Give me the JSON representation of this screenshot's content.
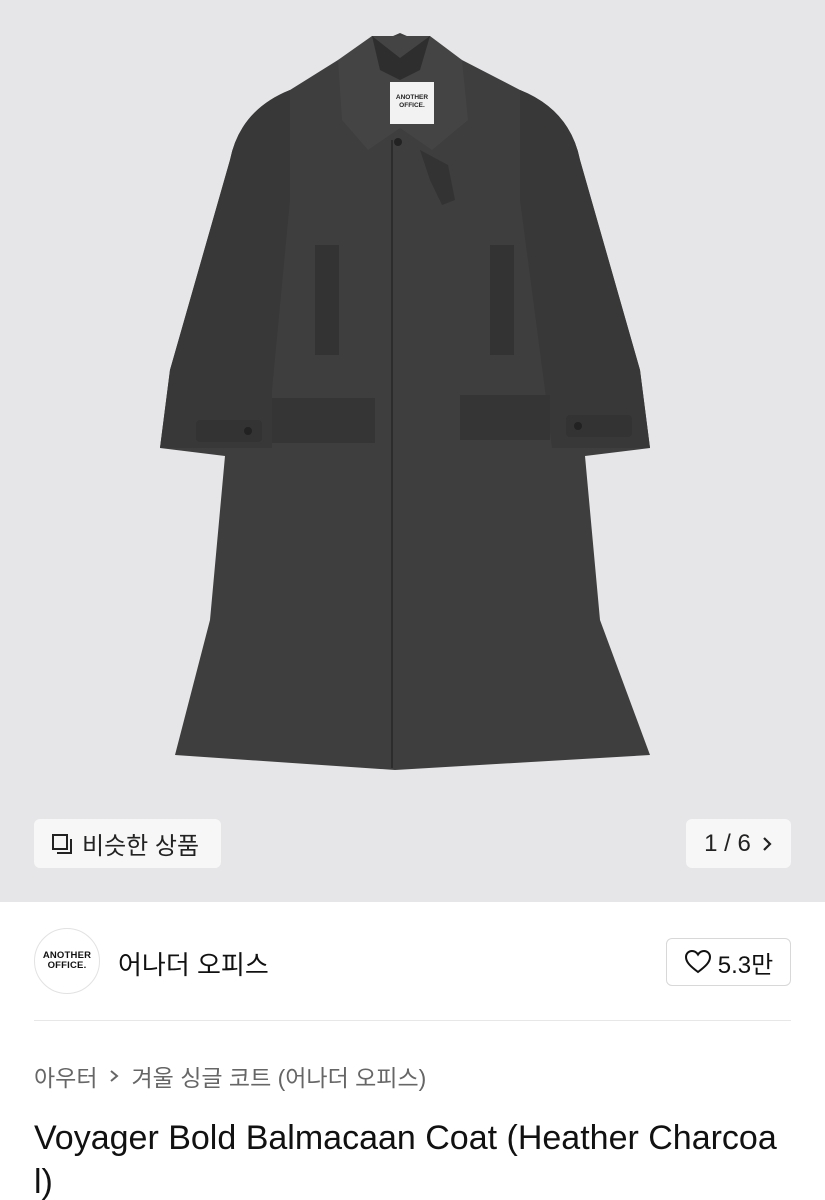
{
  "hero": {
    "garment_label_line1": "ANOTHER",
    "garment_label_line2": "OFFICE."
  },
  "similar": {
    "label": "비슷한 상품",
    "icon": "similar-items-icon"
  },
  "pager": {
    "current": "1",
    "separator": "/",
    "total": "6",
    "icon": "chevron-right-icon"
  },
  "brand": {
    "logo_line1": "ANOTHER",
    "logo_line2": "OFFICE.",
    "name": "어나더 오피스",
    "likes": "5.3만"
  },
  "breadcrumb": {
    "items": [
      "아우터",
      "겨울 싱글 코트 (어나더 오피스)"
    ]
  },
  "product": {
    "title": "Voyager Bold Balmacaan Coat (Heather Charcoal)"
  },
  "colors": {
    "hero_bg": "#e6e6e8",
    "coat": "#3d3d3d",
    "text": "#111111",
    "muted": "#666666"
  }
}
